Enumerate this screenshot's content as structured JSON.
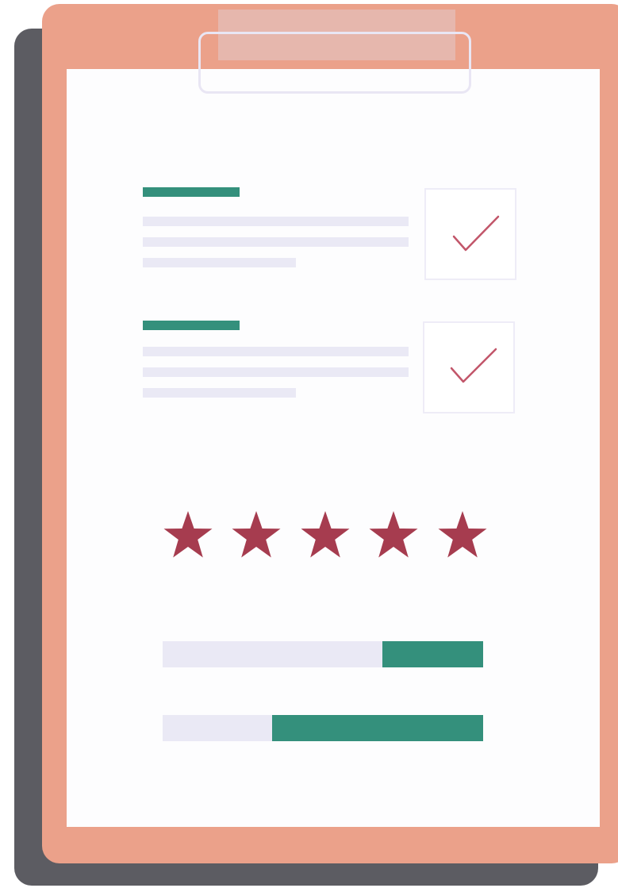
{
  "colors": {
    "shadow": "#5c5c62",
    "board": "#eba18a",
    "paper": "#fdfdfe",
    "clip_band": "#e6b7ad",
    "clip_ring": "#e9e6f4",
    "heading_accent": "#34907c",
    "text_line": "#eae9f5",
    "check_mark": "#c2566a",
    "star": "#a63c4f",
    "progress_track": "#eae9f5",
    "progress_fill": "#34907c"
  },
  "checklist": [
    {
      "icon": "check-icon",
      "checked": true
    },
    {
      "icon": "check-icon",
      "checked": true
    }
  ],
  "rating": {
    "value": 5,
    "max": 5,
    "icon": "star-icon"
  },
  "progress": [
    {
      "fill_fraction": 0.315
    },
    {
      "fill_fraction": 0.658
    }
  ]
}
